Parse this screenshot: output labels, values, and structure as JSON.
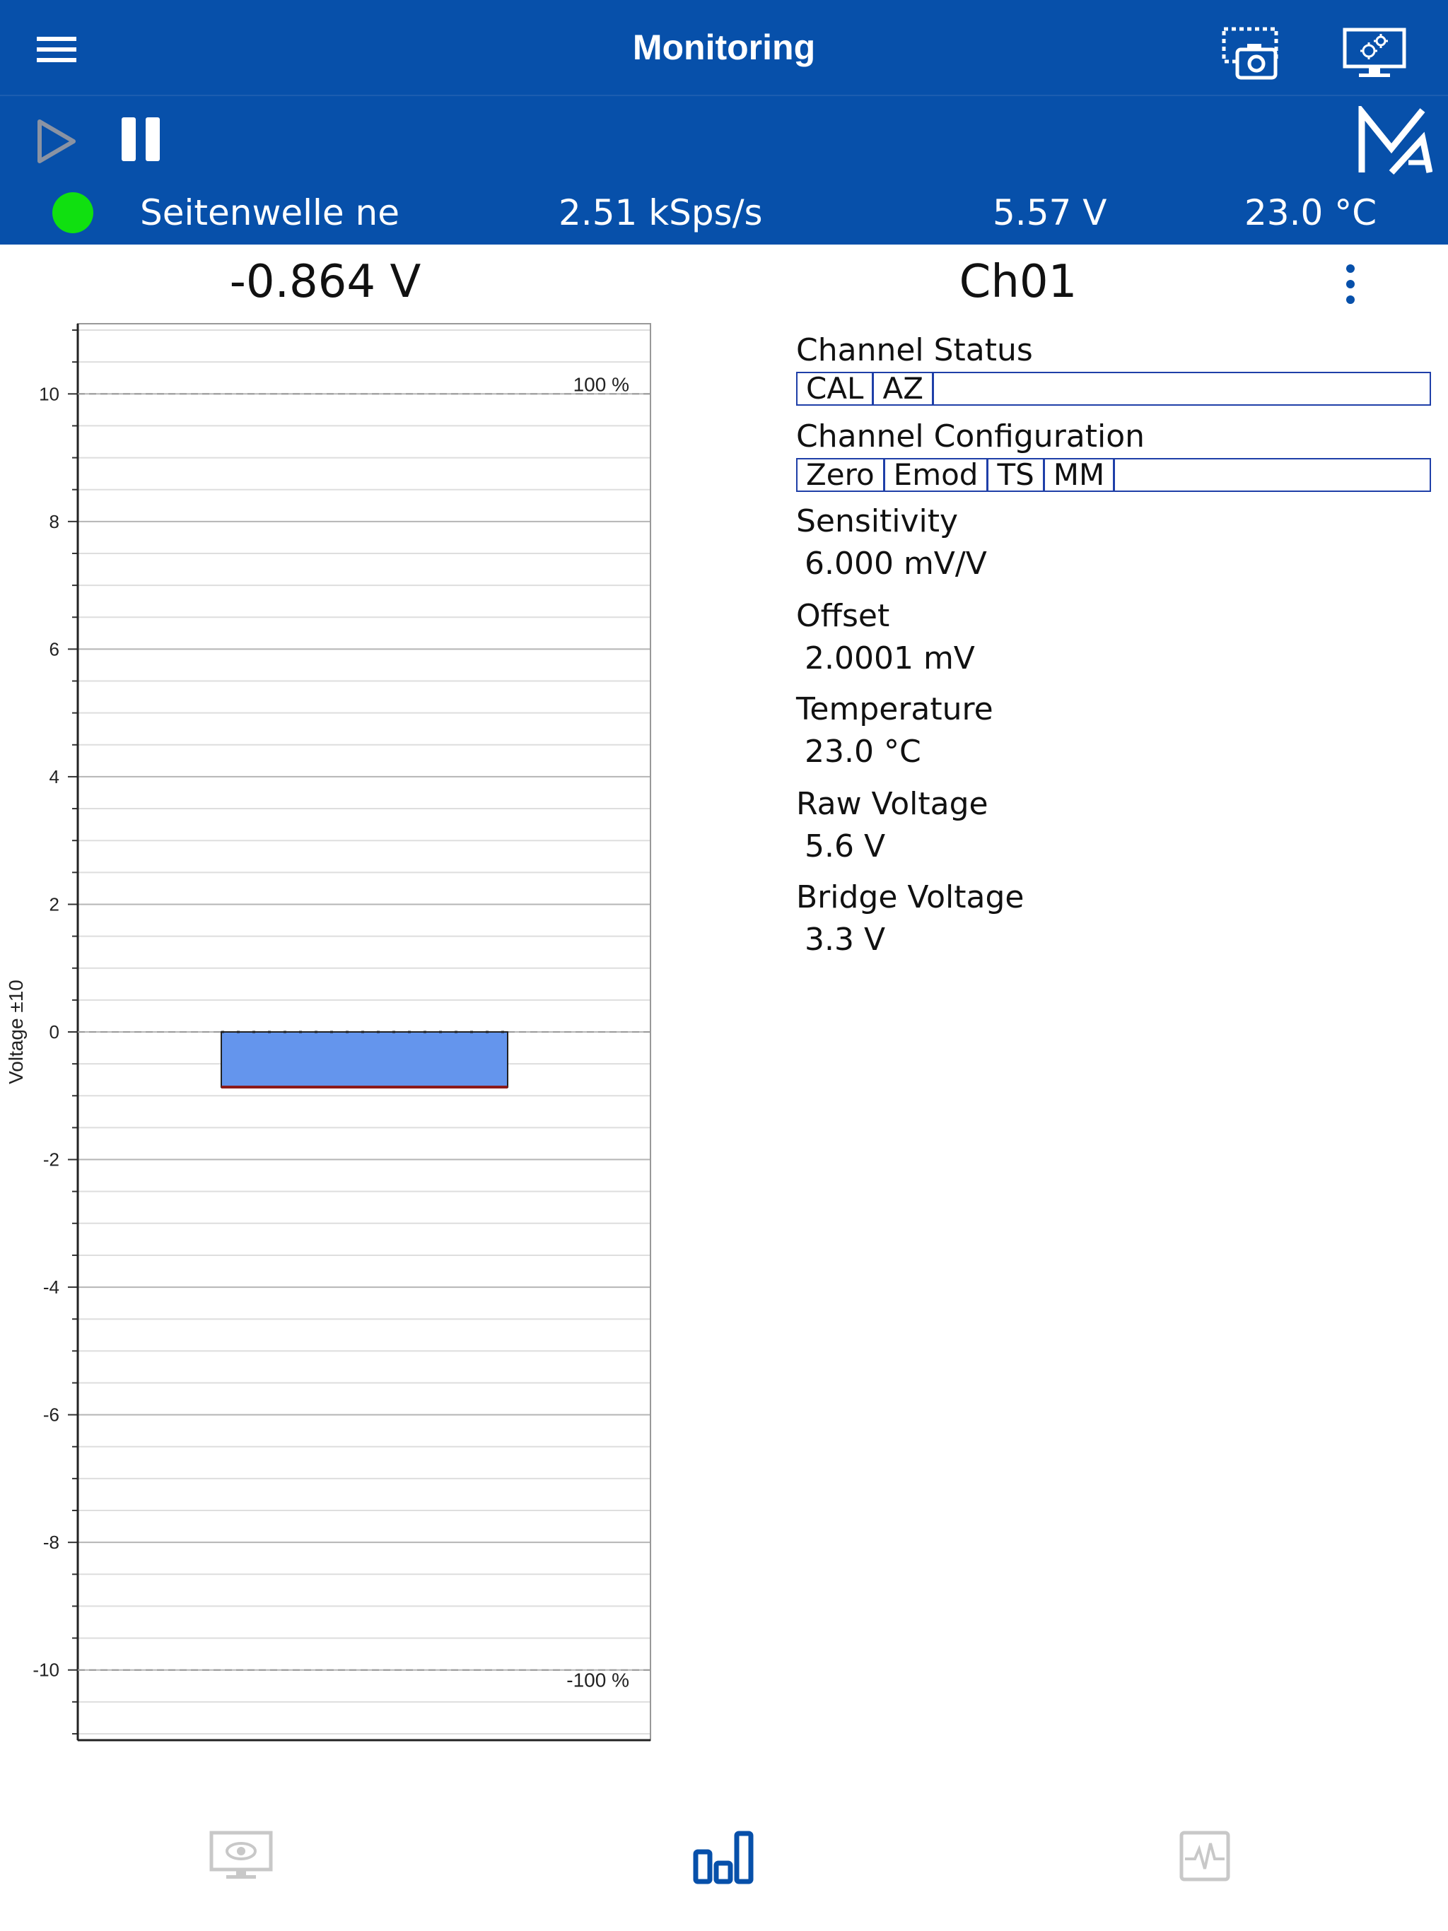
{
  "header": {
    "title": "Monitoring",
    "icons": {
      "menu": "hamburger-menu-icon",
      "screenshot": "screenshot-camera-icon",
      "settings": "monitor-settings-icon",
      "play": "play-icon",
      "pause": "pause-icon",
      "logo": "brand-logo"
    },
    "colors": {
      "bar": "#0750aa",
      "status_ok": "#10e010"
    }
  },
  "status": {
    "device_name": "Seitenwelle net",
    "sample_rate": "2.51 kSps/s",
    "supply_voltage": "5.57 V",
    "temperature": "23.0 °C"
  },
  "readout": {
    "value": "-0.864 V"
  },
  "chart_data": {
    "type": "bar",
    "categories": [
      ""
    ],
    "values": [
      -0.864
    ],
    "title": "",
    "xlabel": "",
    "ylabel": "Voltage ±10",
    "ylim": [
      -11.1,
      11.1
    ],
    "yticks": [
      10,
      8,
      6,
      4,
      2,
      0,
      -2,
      -4,
      -6,
      -8,
      -10
    ],
    "ytick_labels": [
      "10",
      "8",
      "6",
      "4",
      "2",
      "0",
      "-2",
      "-4",
      "-6",
      "-8",
      "-10"
    ],
    "minor_grid_step": 0.5,
    "reference_lines": [
      {
        "value": 10,
        "label": "100 %"
      },
      {
        "value": -10,
        "label": "-100 %"
      }
    ],
    "bar_color": "#6495ed",
    "bar_edge_color": "#8b1a1a",
    "grid": true
  },
  "channel": {
    "name": "Ch01",
    "status_label": "Channel Status",
    "status_tags": [
      "CAL",
      "AZ"
    ],
    "config_label": "Channel Configuration",
    "config_tags": [
      "Zero",
      "Emod",
      "TS",
      "MM"
    ],
    "properties": [
      {
        "label": "Sensitivity",
        "value": "6.000 mV/V"
      },
      {
        "label": "Offset",
        "value": "2.0001 mV"
      },
      {
        "label": "Temperature",
        "value": "23.0 °C"
      },
      {
        "label": "Raw Voltage",
        "value": "5.6 V"
      },
      {
        "label": "Bridge Voltage",
        "value": "3.3 V"
      }
    ]
  },
  "bottom_nav": {
    "items": [
      {
        "icon": "monitor-view-icon",
        "active": false
      },
      {
        "icon": "bar-chart-icon",
        "active": true
      },
      {
        "icon": "waveform-icon",
        "active": false
      }
    ],
    "colors": {
      "active": "#0750aa",
      "inactive": "#c8c8c8"
    }
  }
}
